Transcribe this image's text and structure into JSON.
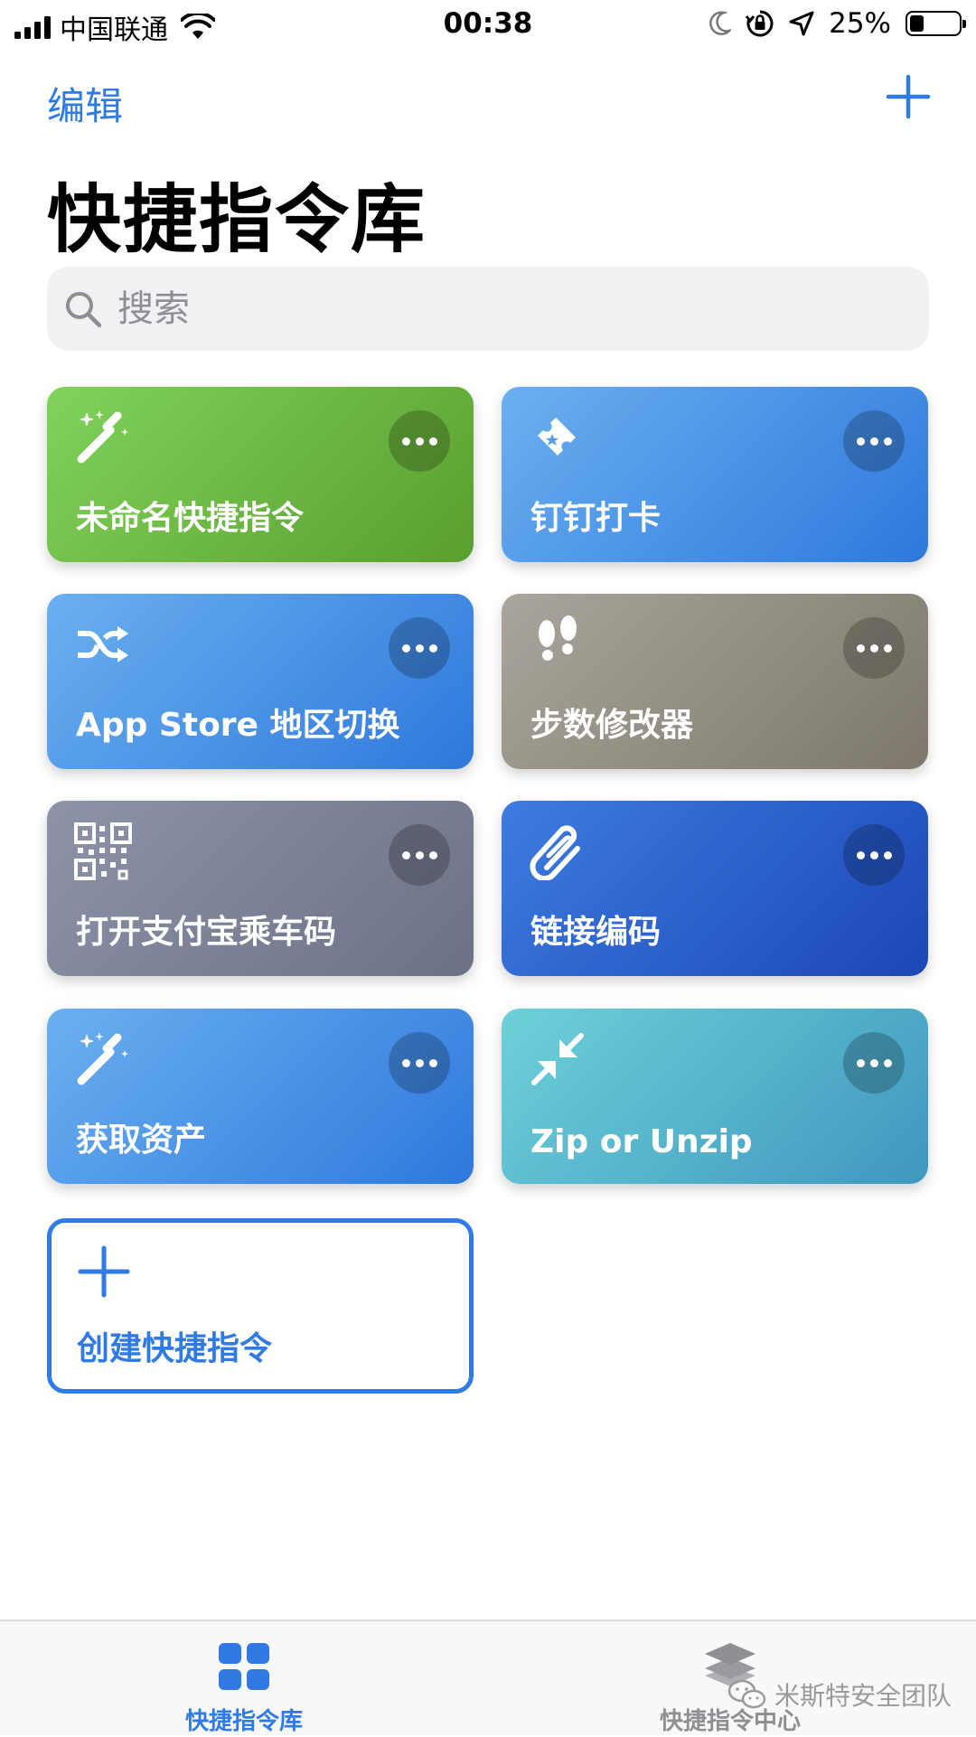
{
  "status_bar": {
    "carrier": "中国联通",
    "time": "00:38",
    "battery_percent": "25%",
    "battery_level": 0.25,
    "icons": [
      "signal-icon",
      "wifi-icon",
      "moon-icon",
      "orientation-lock-icon",
      "location-icon",
      "battery-icon"
    ]
  },
  "nav": {
    "edit_label": "编辑",
    "add_icon": "plus-icon"
  },
  "page": {
    "title": "快捷指令库"
  },
  "search": {
    "placeholder": "搜索",
    "value": ""
  },
  "shortcuts": [
    {
      "label": "未命名快捷指令",
      "icon": "magic-wand-icon",
      "color": "#6cbf45"
    },
    {
      "label": "钉钉打卡",
      "icon": "ticket-icon",
      "color": "#4a92e6"
    },
    {
      "label": "App Store 地区切换",
      "icon": "shuffle-icon",
      "color": "#4a92e6"
    },
    {
      "label": "步数修改器",
      "icon": "footprints-icon",
      "color": "#938e82"
    },
    {
      "label": "打开支付宝乘车码",
      "icon": "qr-code-icon",
      "color": "#7c8196"
    },
    {
      "label": "链接编码",
      "icon": "paperclip-icon",
      "color": "#2a5fcc"
    },
    {
      "label": "获取资产",
      "icon": "magic-wand-icon",
      "color": "#4a92e6"
    },
    {
      "label": "Zip or Unzip",
      "icon": "compress-arrows-icon",
      "color": "#55b6cc"
    }
  ],
  "create": {
    "label": "创建快捷指令",
    "icon": "plus-icon"
  },
  "tabbar": {
    "tabs": [
      {
        "label": "快捷指令库",
        "icon": "grid-icon",
        "active": true,
        "color": "#2f7ae5"
      },
      {
        "label": "快捷指令中心",
        "icon": "layers-icon",
        "active": false,
        "color": "#8e8e93"
      }
    ]
  },
  "watermark": {
    "text": "米斯特安全团队",
    "icon": "wechat-icon"
  },
  "colors": {
    "accent": "#2f7ae5"
  }
}
